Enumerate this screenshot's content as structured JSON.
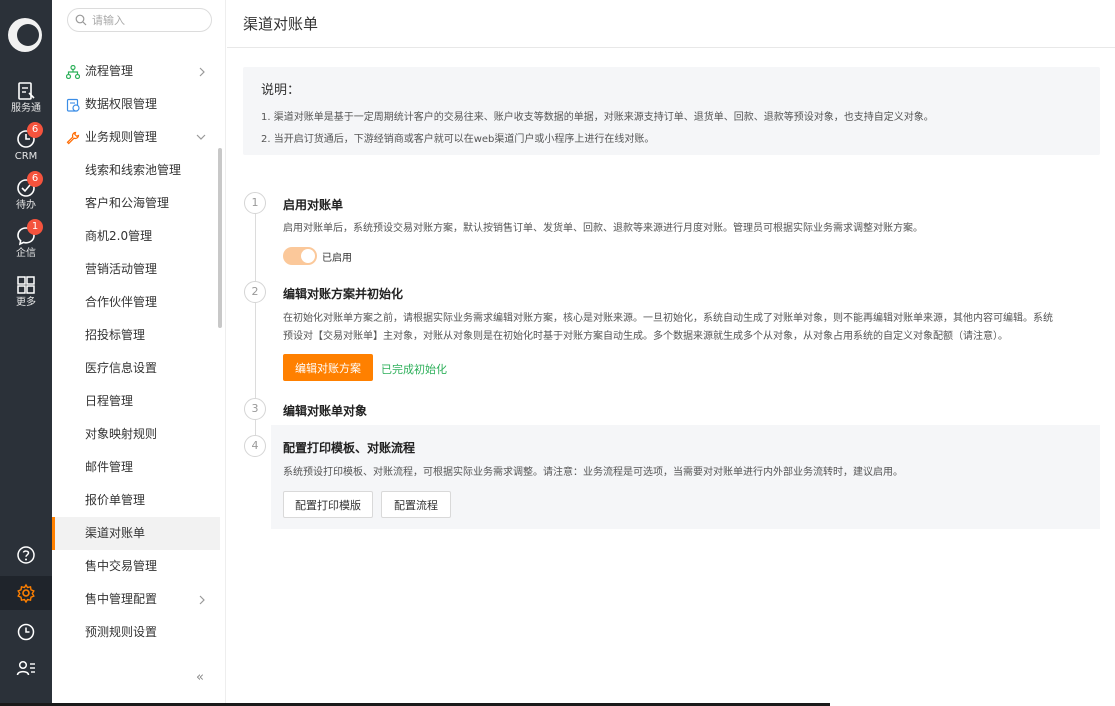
{
  "rail": {
    "items": [
      {
        "label": "服务通",
        "icon": "service-icon"
      },
      {
        "label": "CRM",
        "icon": "crm-clock-icon",
        "badge": "6"
      },
      {
        "label": "待办",
        "icon": "todo-check-icon",
        "badge": "6"
      },
      {
        "label": "企信",
        "icon": "chat-bubble-icon",
        "badge": "1"
      },
      {
        "label": "更多",
        "icon": "grid-more-icon"
      }
    ],
    "bottom_icons": [
      "help-icon",
      "settings-gear-icon",
      "history-clock-icon",
      "user-list-icon"
    ]
  },
  "sidebar": {
    "search_placeholder": "请输入",
    "menu": [
      {
        "label": "流程管理",
        "icon": "flow-icon",
        "chevron": "right"
      },
      {
        "label": "数据权限管理",
        "icon": "data-permission-icon"
      },
      {
        "label": "业务规则管理",
        "icon": "rules-wrench-icon",
        "chevron": "down"
      },
      {
        "label": "线索和线索池管理"
      },
      {
        "label": "客户和公海管理"
      },
      {
        "label": "商机2.0管理"
      },
      {
        "label": "营销活动管理"
      },
      {
        "label": "合作伙伴管理"
      },
      {
        "label": "招投标管理"
      },
      {
        "label": "医疗信息设置"
      },
      {
        "label": "日程管理"
      },
      {
        "label": "对象映射规则"
      },
      {
        "label": "邮件管理"
      },
      {
        "label": "报价单管理"
      },
      {
        "label": "渠道对账单",
        "active": true
      },
      {
        "label": "售中交易管理"
      },
      {
        "label": "售中管理配置",
        "chevron": "right"
      },
      {
        "label": "预测规则设置"
      }
    ],
    "collapse_label": "«"
  },
  "main": {
    "title": "渠道对账单",
    "notice": {
      "title": "说明：",
      "lines": [
        "1. 渠道对账单是基于一定周期统计客户的交易往来、账户收支等数据的单据，对账来源支持订单、退货单、回款、退款等预设对象，也支持自定义对象。",
        "2. 当开启订货通后，下游经销商或客户就可以在web渠道门户或小程序上进行在线对账。"
      ]
    },
    "steps": [
      {
        "number": "1",
        "title": "启用对账单",
        "desc": "启用对账单后，系统预设交易对账方案，默认按销售订单、发货单、回款、退款等来源进行月度对账。管理员可根据实际业务需求调整对账方案。",
        "toggle_label": "已启用",
        "toggle_on": true
      },
      {
        "number": "2",
        "title": "编辑对账方案并初始化",
        "desc1": "在初始化对账单方案之前，请根据实际业务需求编辑对账方案，核心是对账来源。一旦初始化，系统自动生成了对账单对象，则不能再编辑对账单来源，其他内容可编辑。系统",
        "desc2": "预设对【交易对账单】主对象，对账从对象则是在初始化时基于对账方案自动生成。多个数据来源就生成多个从对象，从对象占用系统的自定义对象配额（请注意）。",
        "button": "编辑对账方案",
        "status": "已完成初始化"
      },
      {
        "number": "3",
        "title": "编辑对账单对象"
      },
      {
        "number": "4",
        "title": "配置打印模板、对账流程",
        "desc": "系统预设打印模板、对账流程，可根据实际业务需求调整。请注意：业务流程是可选项，当需要对对账单进行内外部业务流转时，建议启用。",
        "button1": "配置打印模版",
        "button2": "配置流程"
      }
    ]
  },
  "colors": {
    "accent": "#ff8000",
    "rail_bg": "#2b3139",
    "badge": "#f5533d",
    "success": "#2fb05b",
    "panel_bg": "#f5f6f8"
  }
}
